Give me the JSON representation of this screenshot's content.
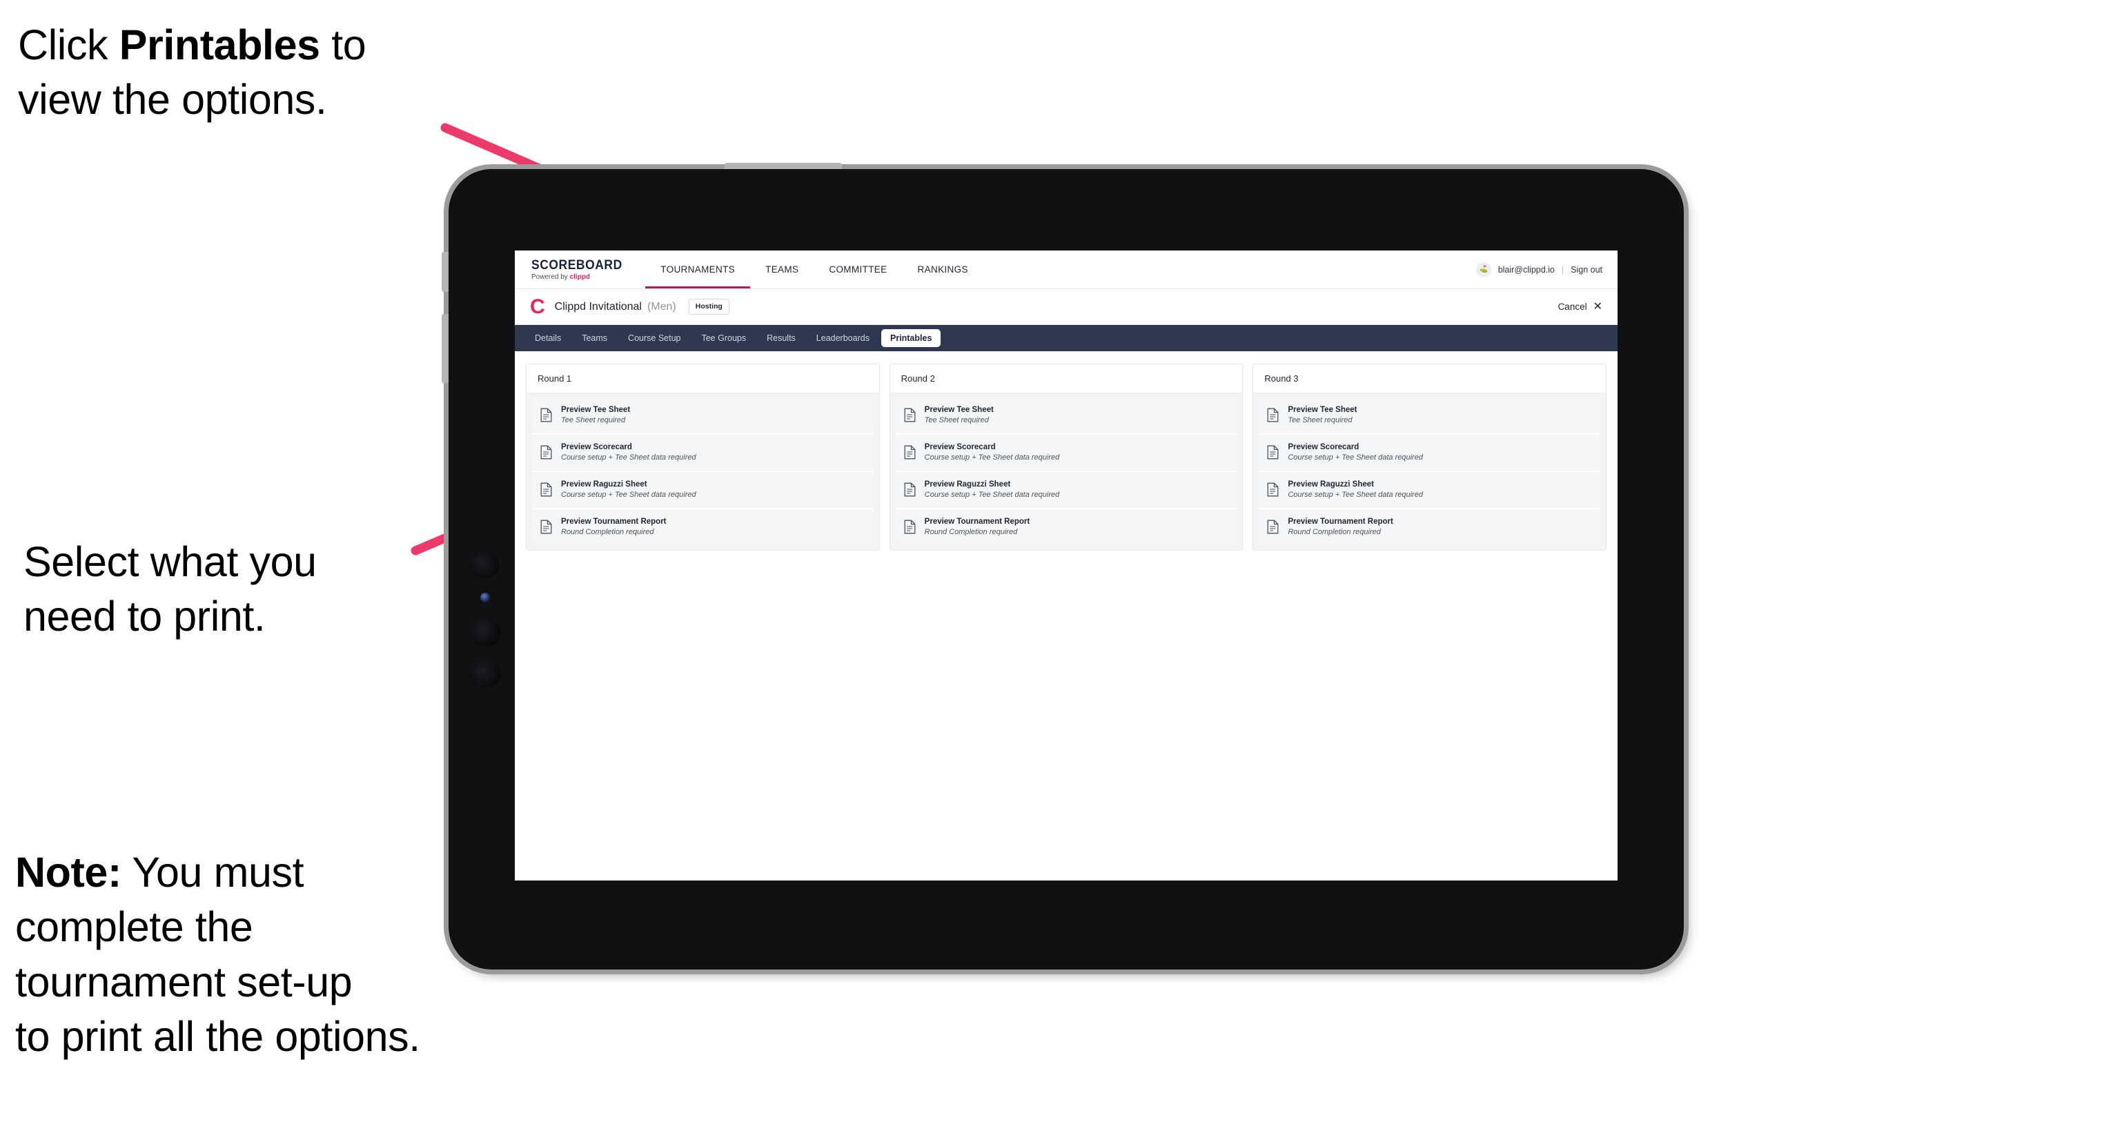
{
  "annotations": {
    "click_printables": {
      "prefix": "Click ",
      "bold": "Printables",
      "suffix": " to\nview the options."
    },
    "select_print": "Select what you\n need to print.",
    "note": {
      "bold": "Note:",
      "text": " You must\ncomplete the\ntournament set-up\nto print all the options."
    }
  },
  "colors": {
    "accent_pink": "#EE3A6B",
    "brand_red": "#E4265B",
    "tabstrip_dark": "#2E3950",
    "active_underline": "#C2185B"
  },
  "app": {
    "brand": {
      "title": "SCOREBOARD",
      "powered_prefix": "Powered by ",
      "powered_brand": "clippd"
    },
    "topnav": [
      {
        "label": "TOURNAMENTS",
        "active": true
      },
      {
        "label": "TEAMS",
        "active": false
      },
      {
        "label": "COMMITTEE",
        "active": false
      },
      {
        "label": "RANKINGS",
        "active": false
      }
    ],
    "account": {
      "avatar_glyph": "⛳",
      "email": "blair@clippd.io",
      "separator": "|",
      "sign_out": "Sign out"
    },
    "tournament": {
      "logo_letter": "C",
      "name": "Clippd Invitational",
      "gender": "(Men)",
      "badge": "Hosting",
      "cancel_label": "Cancel",
      "cancel_icon": "✕"
    },
    "tabs": [
      {
        "label": "Details",
        "active": false
      },
      {
        "label": "Teams",
        "active": false
      },
      {
        "label": "Course Setup",
        "active": false
      },
      {
        "label": "Tee Groups",
        "active": false
      },
      {
        "label": "Results",
        "active": false
      },
      {
        "label": "Leaderboards",
        "active": false
      },
      {
        "label": "Printables",
        "active": true
      }
    ],
    "rounds": [
      {
        "title": "Round 1",
        "items": [
          {
            "title": "Preview Tee Sheet",
            "sub": "Tee Sheet required"
          },
          {
            "title": "Preview Scorecard",
            "sub": "Course setup + Tee Sheet data required"
          },
          {
            "title": "Preview Raguzzi Sheet",
            "sub": "Course setup + Tee Sheet data required"
          },
          {
            "title": "Preview Tournament Report",
            "sub": "Round Completion required"
          }
        ]
      },
      {
        "title": "Round 2",
        "items": [
          {
            "title": "Preview Tee Sheet",
            "sub": "Tee Sheet required"
          },
          {
            "title": "Preview Scorecard",
            "sub": "Course setup + Tee Sheet data required"
          },
          {
            "title": "Preview Raguzzi Sheet",
            "sub": "Course setup + Tee Sheet data required"
          },
          {
            "title": "Preview Tournament Report",
            "sub": "Round Completion required"
          }
        ]
      },
      {
        "title": "Round 3",
        "items": [
          {
            "title": "Preview Tee Sheet",
            "sub": "Tee Sheet required"
          },
          {
            "title": "Preview Scorecard",
            "sub": "Course setup + Tee Sheet data required"
          },
          {
            "title": "Preview Raguzzi Sheet",
            "sub": "Course setup + Tee Sheet data required"
          },
          {
            "title": "Preview Tournament Report",
            "sub": "Round Completion required"
          }
        ]
      }
    ]
  }
}
